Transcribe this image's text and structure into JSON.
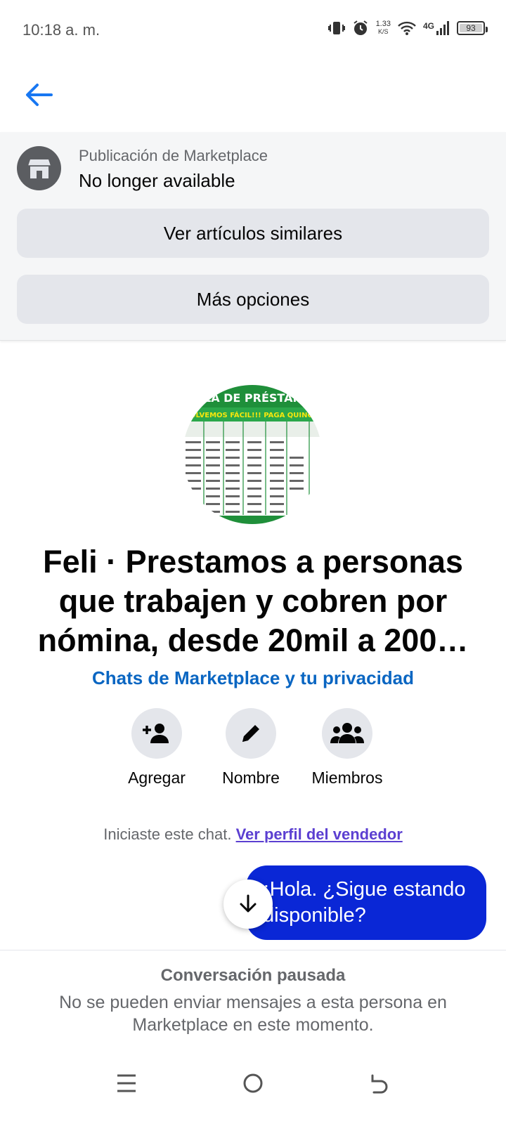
{
  "status_bar": {
    "time": "10:18 a. m.",
    "net_speed_value": "1.33",
    "net_speed_unit": "K/S",
    "network": "4G",
    "battery": "93"
  },
  "marketplace": {
    "label": "Publicación de Marketplace",
    "status": "No longer available",
    "similar_button": "Ver artículos similares",
    "options_button": "Más opciones"
  },
  "profile": {
    "photo_lines": [
      "LA DE PRÉSTAM",
      "OLVEMOS FÁCIL!!!  PAGA QUINCENA"
    ],
    "title": "Feli · Prestamos a personas que trabajen y cobren por nómina, desde 20mil a 200…",
    "privacy_link": "Chats de Marketplace y tu privacidad"
  },
  "actions": [
    {
      "label": "Agregar",
      "icon": "add-person-icon"
    },
    {
      "label": "Nombre",
      "icon": "pencil-icon"
    },
    {
      "label": "Miembros",
      "icon": "group-icon"
    }
  ],
  "chat": {
    "started_text": "Iniciaste este chat.",
    "seller_link": "Ver perfil del vendedor",
    "message": "¡Hola. ¿Sigue estando disponible?"
  },
  "paused": {
    "title": "Conversación pausada",
    "description": "No se pueden enviar mensajes a esta persona en Marketplace en este momento."
  },
  "colors": {
    "accent": "#0a66c2",
    "bubble": "#0a27d6",
    "link_purple": "#5b3fd1"
  }
}
